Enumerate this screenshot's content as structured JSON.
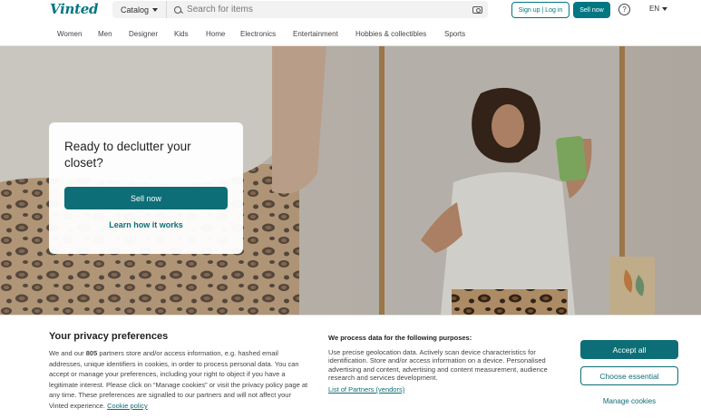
{
  "header": {
    "logo": "Vinted",
    "catalog_label": "Catalog",
    "search_placeholder": "Search for items",
    "signup_label": "Sign up | Log in",
    "sell_label": "Sell now",
    "help_glyph": "?",
    "language": "EN",
    "icons": [
      "chevron-down-icon",
      "search-icon",
      "camera-icon",
      "help-icon"
    ]
  },
  "categories": [
    "Women",
    "Men",
    "Designer",
    "Kids",
    "Home",
    "Electronics",
    "Entertainment",
    "Hobbies & collectibles",
    "Sports"
  ],
  "hero": {
    "title": "Ready to declutter your closet?",
    "sell_button": "Sell now",
    "learn_link": "Learn how it works"
  },
  "cookie": {
    "title": "Your privacy preferences",
    "text_part1": "We and our ",
    "partner_count": "805",
    "text_part2": " partners store and/or access information, e.g. hashed email addresses, unique identifiers in cookies, in order to process personal data. You can accept or manage your preferences, including your right to object if you have a legitimate interest. Please click on “Manage cookies” or visit the privacy policy page at any time. These preferences are signalled to our partners and will not affect your Vinted experience.",
    "policy_link": "Cookie policy",
    "purposes_title": "We process data for the following purposes:",
    "purposes_text": "Use precise geolocation data. Actively scan device characteristics for identification. Store and/or access information on a device. Personalised advertising and content, advertising and content measurement, audience research and services development.",
    "partners_link": "List of Partners (vendors)",
    "accept_all": "Accept all",
    "choose_essential": "Choose essential",
    "manage_cookies": "Manage cookies"
  },
  "colors": {
    "brand": "#007782",
    "brand_dark": "#0d6e77"
  }
}
